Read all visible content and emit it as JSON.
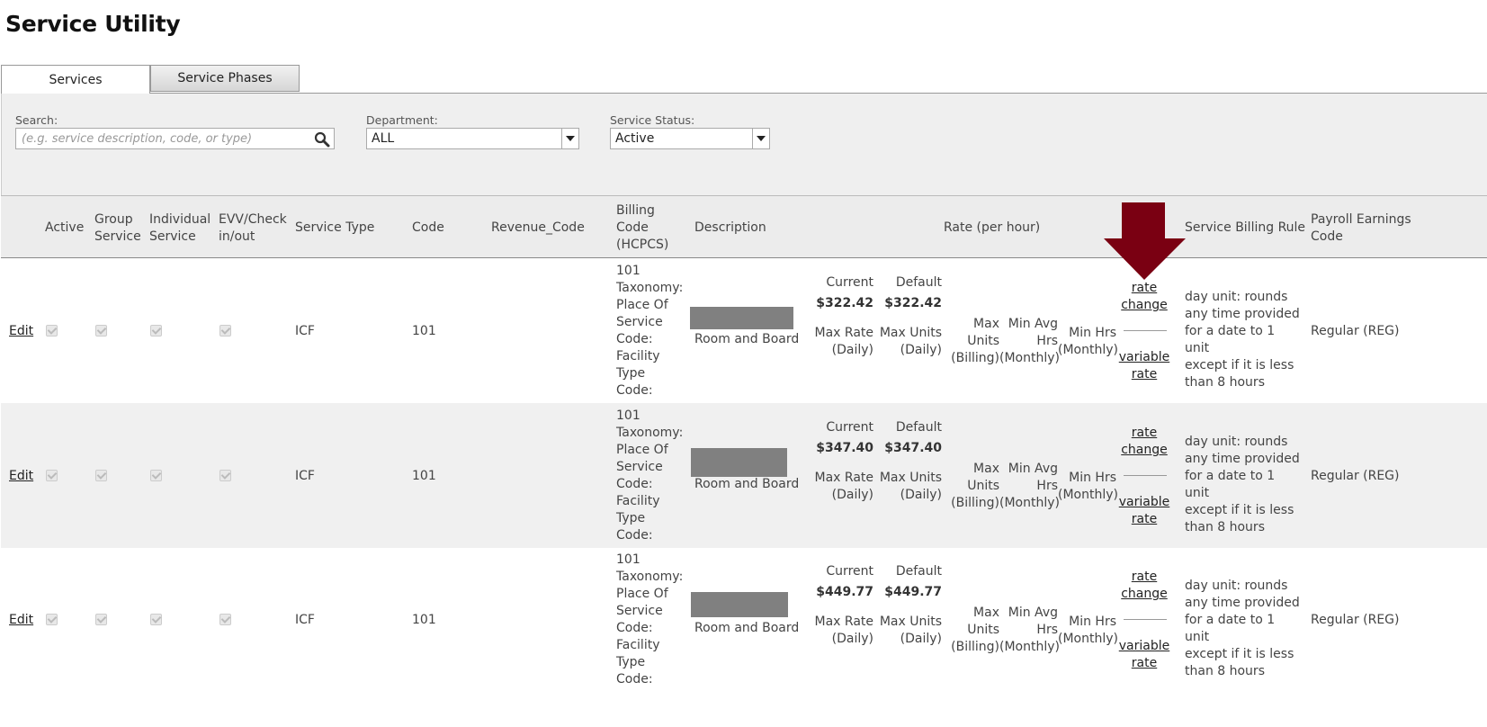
{
  "page_title": "Service Utility",
  "tabs": [
    {
      "label": "Services"
    },
    {
      "label": "Service Phases"
    }
  ],
  "filters": {
    "search_label": "Search:",
    "search_placeholder": "(e.g. service description, code, or type)",
    "department_label": "Department:",
    "department_value": "ALL",
    "status_label": "Service Status:",
    "status_value": "Active"
  },
  "columns": {
    "active": "Active",
    "group": [
      "Group",
      "Service"
    ],
    "individual": [
      "Individual",
      "Service"
    ],
    "evv": [
      "EVV/Check",
      "in/out"
    ],
    "service_type": "Service Type",
    "code": "Code",
    "revenue_code": "Revenue_Code",
    "billing": [
      "Billing",
      "Code",
      "(HCPCS)"
    ],
    "description": "Description",
    "rate": "Rate (per hour)",
    "billing_rule": "Service Billing Rule",
    "payroll": [
      "Payroll Earnings",
      "Code"
    ]
  },
  "rows": [
    {
      "edit": "Edit",
      "service_type": "ICF",
      "code": "101",
      "billing": [
        "101",
        "Taxonomy:",
        "Place Of",
        "Service",
        "Code:",
        "Facility",
        "Type",
        "Code:"
      ],
      "description": "Room and Board",
      "current_label": "Current",
      "current": "$322.42",
      "default_label": "Default",
      "default": "$322.42",
      "max_rate": [
        "Max Rate",
        "(Daily)"
      ],
      "max_units": [
        "Max Units",
        "(Daily)"
      ],
      "max_units_billing": [
        "Max",
        "Units",
        "(Billing)"
      ],
      "min_avg_hrs": [
        "Min Avg",
        "Hrs",
        "(Monthly)"
      ],
      "min_hrs": [
        "Min Hrs",
        "(Monthly)"
      ],
      "rate_change": [
        "rate",
        "change"
      ],
      "variable_rate": [
        "variable",
        "rate"
      ],
      "billing_rule": [
        "day unit: rounds",
        "any time provided",
        "for a date to 1 unit",
        "except if it is less",
        "than 8 hours"
      ],
      "payroll": "Regular (REG)"
    },
    {
      "edit": "Edit",
      "service_type": "ICF",
      "code": "101",
      "billing": [
        "101",
        "Taxonomy:",
        "Place Of",
        "Service",
        "Code:",
        "Facility",
        "Type",
        "Code:"
      ],
      "description": "Room and Board",
      "current_label": "Current",
      "current": "$347.40",
      "default_label": "Default",
      "default": "$347.40",
      "max_rate": [
        "Max Rate",
        "(Daily)"
      ],
      "max_units": [
        "Max Units",
        "(Daily)"
      ],
      "max_units_billing": [
        "Max",
        "Units",
        "(Billing)"
      ],
      "min_avg_hrs": [
        "Min Avg",
        "Hrs",
        "(Monthly)"
      ],
      "min_hrs": [
        "Min Hrs",
        "(Monthly)"
      ],
      "rate_change": [
        "rate",
        "change"
      ],
      "variable_rate": [
        "variable",
        "rate"
      ],
      "billing_rule": [
        "day unit: rounds",
        "any time provided",
        "for a date to 1 unit",
        "except if it is less",
        "than 8 hours"
      ],
      "payroll": "Regular (REG)"
    },
    {
      "edit": "Edit",
      "service_type": "ICF",
      "code": "101",
      "billing": [
        "101",
        "Taxonomy:",
        "Place Of",
        "Service",
        "Code:",
        "Facility",
        "Type",
        "Code:"
      ],
      "description": "Room and Board",
      "current_label": "Current",
      "current": "$449.77",
      "default_label": "Default",
      "default": "$449.77",
      "max_rate": [
        "Max Rate",
        "(Daily)"
      ],
      "max_units": [
        "Max Units",
        "(Daily)"
      ],
      "max_units_billing": [
        "Max",
        "Units",
        "(Billing)"
      ],
      "min_avg_hrs": [
        "Min Avg",
        "Hrs",
        "(Monthly)"
      ],
      "min_hrs": [
        "Min Hrs",
        "(Monthly)"
      ],
      "rate_change": [
        "rate",
        "change"
      ],
      "variable_rate": [
        "variable",
        "rate"
      ],
      "billing_rule": [
        "day unit: rounds",
        "any time provided",
        "for a date to 1 unit",
        "except if it is less",
        "than 8 hours"
      ],
      "payroll": "Regular (REG)"
    }
  ],
  "colors": {
    "arrow": "#7a0012",
    "panel_bg": "#efefef",
    "alt_row": "#f0f0f0"
  },
  "icons": {
    "search": "search-icon",
    "dropdown": "chevron-down-icon",
    "annotation": "arrow-down-icon"
  }
}
